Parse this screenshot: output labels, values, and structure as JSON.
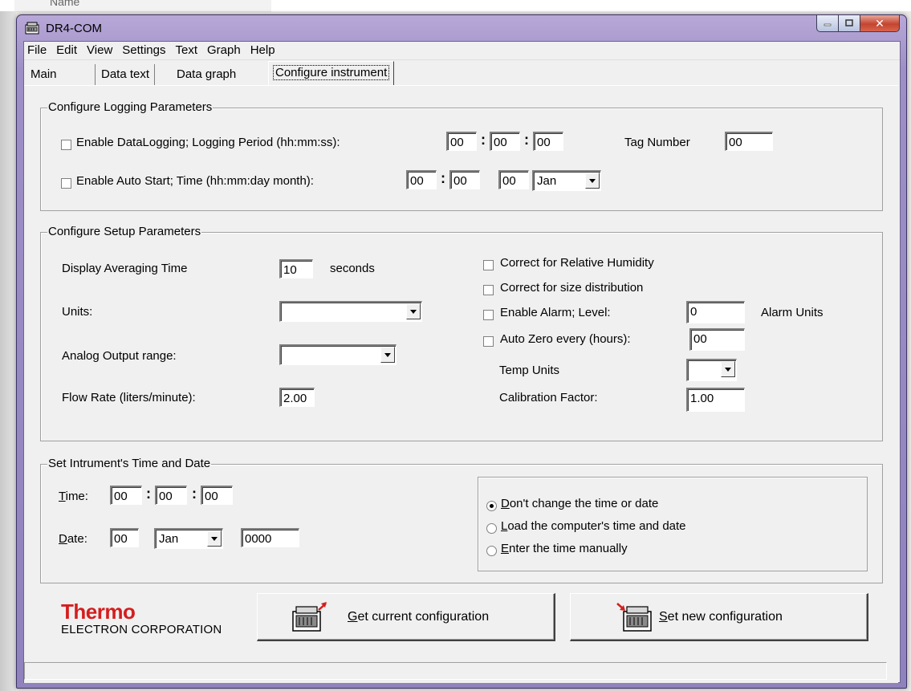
{
  "background": {
    "scrap_text": "Name"
  },
  "window": {
    "title": "DR4-COM",
    "accent": "#9e90c6"
  },
  "menu": [
    "File",
    "Edit",
    "View",
    "Settings",
    "Text",
    "Graph",
    "Help"
  ],
  "tabs": [
    "Main",
    "Data text",
    "Data graph",
    "Configure instrument"
  ],
  "active_tab": "Configure instrument",
  "logging": {
    "title": "Configure Logging Parameters",
    "enable_datalogging_label": "Enable DataLogging;  Logging Period (hh:mm:ss):",
    "enable_datalogging_checked": false,
    "period_hh": "00",
    "period_mm": "00",
    "period_ss": "00",
    "tag_label": "Tag Number",
    "tag_value": "00",
    "enable_autostart_label": "Enable Auto Start;  Time (hh:mm:day month):",
    "enable_autostart_checked": false,
    "start_hh": "00",
    "start_mm": "00",
    "start_day": "00",
    "start_month": "Jan"
  },
  "setup": {
    "title": "Configure Setup Parameters",
    "display_avg_label": "Display Averaging Time",
    "display_avg_value": "10",
    "display_avg_unit": "seconds",
    "units_label": "Units:",
    "units_value": "",
    "analog_label": "Analog Output range:",
    "analog_value": "",
    "flow_label": "Flow Rate (liters/minute):",
    "flow_value": "2.00",
    "rh_label": "Correct for Relative Humidity",
    "size_label": "Correct for size distribution",
    "alarm_label": "Enable Alarm;  Level:",
    "alarm_value": "0",
    "alarm_units": "Alarm Units",
    "autozero_label": "Auto Zero every (hours):",
    "autozero_value": "00",
    "temp_units_label": "Temp Units",
    "temp_units_value": "",
    "cal_label": "Calibration Factor:",
    "cal_value": "1.00"
  },
  "timedate": {
    "title": "Set Intrument's Time and Date",
    "time_label_u": "T",
    "time_label_rest": "ime:",
    "hh": "00",
    "mm": "00",
    "ss": "00",
    "date_label_u": "D",
    "date_label_rest": "ate:",
    "day": "00",
    "month": "Jan",
    "year": "0000",
    "options": [
      {
        "u": "D",
        "rest": "on't change the time or date",
        "selected": true
      },
      {
        "u": "L",
        "rest": "oad the computer's time and date",
        "selected": false
      },
      {
        "u": "E",
        "rest": "nter the time manually",
        "selected": false
      }
    ]
  },
  "footer": {
    "brand": "Thermo",
    "brand_sub": "ELECTRON CORPORATION",
    "brand_color": "#d41e1e",
    "get_u": "G",
    "get_rest": "et current configuration",
    "set_u": "S",
    "set_rest": "et new configuration"
  },
  "status": ""
}
